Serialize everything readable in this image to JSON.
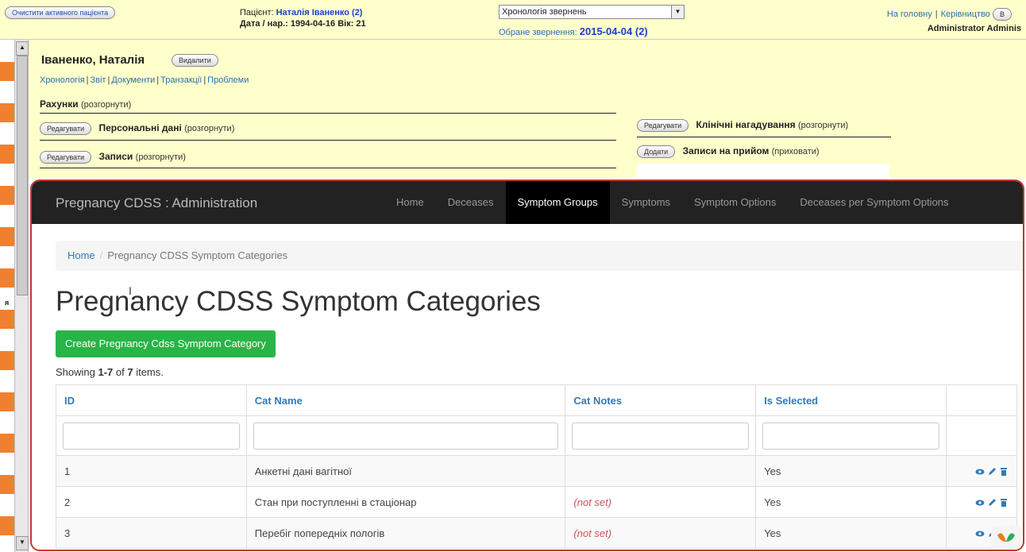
{
  "topbar": {
    "clear_patient": "Очистити активного пацієнта",
    "patient_label": "Пацієнт: ",
    "patient_name": "Наталія Іваненко (2)",
    "dob_line": "Дата / нар.: 1994-04-16 Вік: 21",
    "encounter_select": "Хронологія звернень",
    "encounter_label": "Обране звернення: ",
    "encounter_value": "2015-04-04 (2)",
    "links": [
      "На головну",
      "Керівництво",
      "В"
    ],
    "user": "Administrator Adminis"
  },
  "summary": {
    "patient_title": "Іваненко, Наталія",
    "delete_label": "Видалити",
    "tabs": [
      "Хронологія",
      "Звіт",
      "Документи",
      "Транзакції",
      "Проблеми"
    ],
    "edit_label": "Редагувати",
    "add_label": "Додати",
    "accounts": "Рахунки",
    "expand": "(розгорнути)",
    "collapse": "(приховати)",
    "personal": "Персональні дані",
    "records": "Записи",
    "reminders": "Клінічні нагадування",
    "appointments": "Записи на прийом"
  },
  "admin": {
    "brand": "Pregnancy CDSS : Administration",
    "nav": [
      "Home",
      "Deceases",
      "Symptom Groups",
      "Symptoms",
      "Symptom Options",
      "Deceases per Symptom Options"
    ],
    "active_nav": "Symptom Groups",
    "breadcrumb_home": "Home",
    "breadcrumb_current": "Pregnancy CDSS Symptom Categories",
    "page_title": "Pregnancy CDSS Symptom Categories",
    "create_label": "Create Pregnancy Cdss Symptom Category",
    "showing_prefix": "Showing ",
    "showing_range": "1-7",
    "showing_mid": " of ",
    "showing_total": "7",
    "showing_suffix": " items.",
    "columns": [
      "ID",
      "Cat Name",
      "Cat Notes",
      "Is Selected"
    ],
    "rows": [
      {
        "id": "1",
        "name": "Анкетні дані вагітної",
        "notes": "",
        "selected": "Yes"
      },
      {
        "id": "2",
        "name": "Стан при поступленні в стаціонар",
        "notes": "(not set)",
        "selected": "Yes"
      },
      {
        "id": "3",
        "name": "Перебіг попередніх пологів",
        "notes": "(not set)",
        "selected": "Yes"
      }
    ]
  },
  "colors": {
    "accent_green": "#28b446",
    "navbar": "#222222",
    "link": "#337ab7",
    "frame": "#c0392b"
  }
}
